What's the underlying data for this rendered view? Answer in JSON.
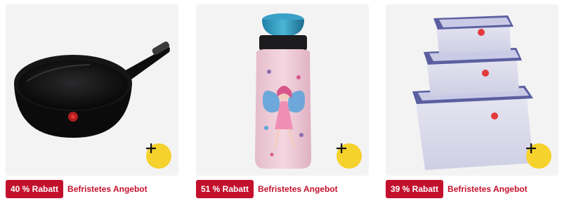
{
  "products": [
    {
      "name": "",
      "badge": "40 % Rabatt",
      "deal": "Befristetes Angebot",
      "add_icon": "plus-icon"
    },
    {
      "name": "",
      "badge": "51 % Rabatt",
      "deal": "Befristetes Angebot",
      "add_icon": "plus-icon"
    },
    {
      "name": "",
      "badge": "39 % Rabatt",
      "deal": "Befristetes Angebot",
      "add_icon": "plus-icon"
    }
  ],
  "colors": {
    "badge_bg": "#c3102c",
    "deal_text": "#c3102c",
    "add_button": "#f5d22c",
    "image_bg": "#f3f3f4"
  }
}
